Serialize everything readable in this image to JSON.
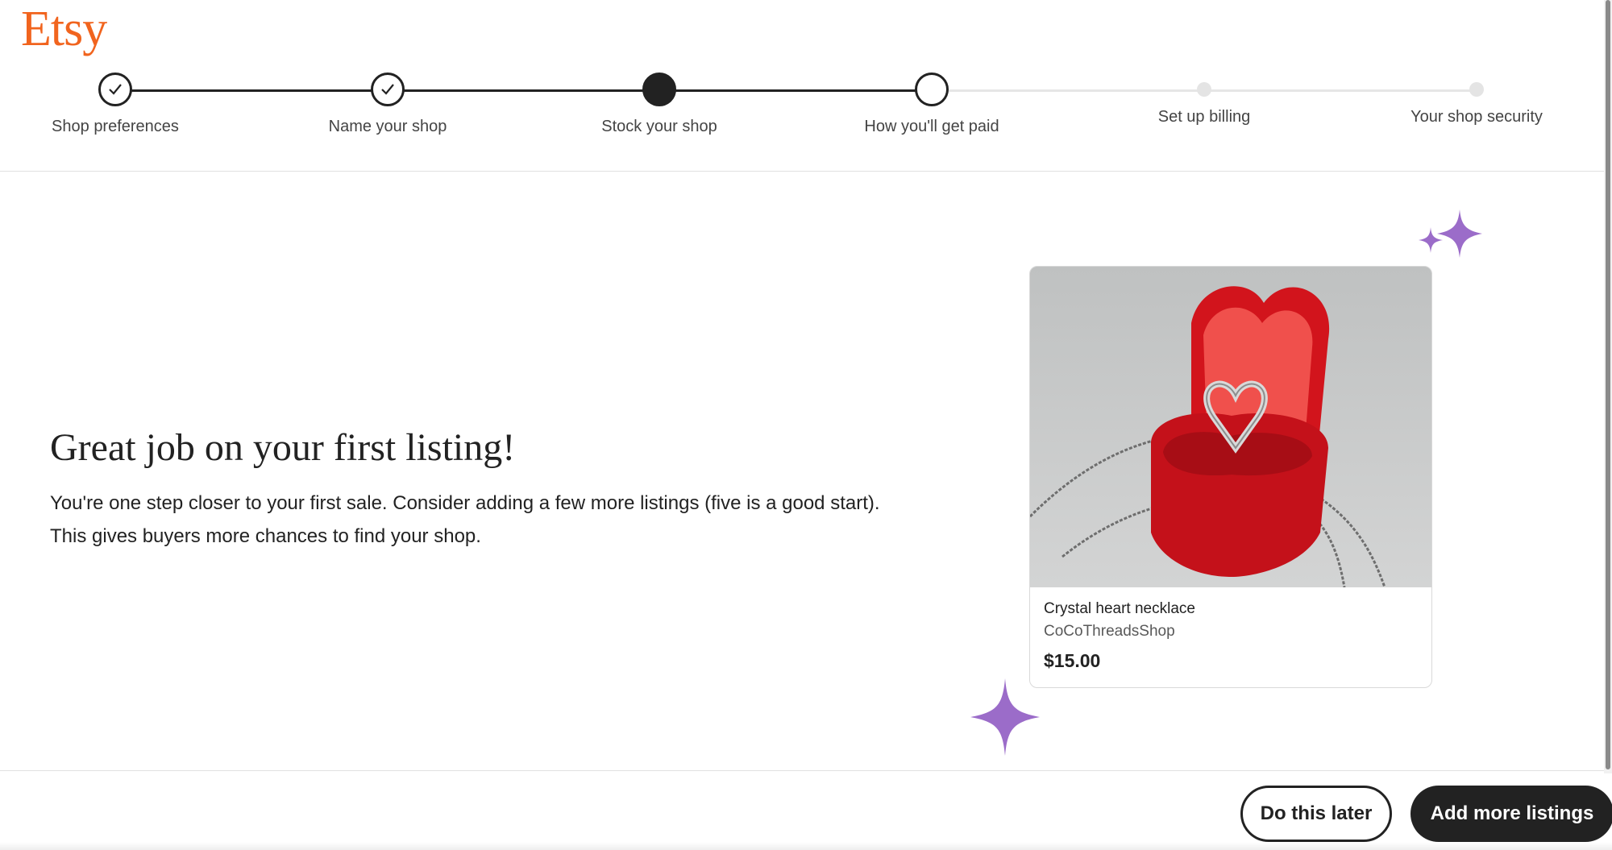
{
  "brand": {
    "logo_text": "Etsy",
    "color": "#f1641e"
  },
  "stepper": {
    "steps": [
      {
        "label": "Shop preferences",
        "state": "completed"
      },
      {
        "label": "Name your shop",
        "state": "completed"
      },
      {
        "label": "Stock your shop",
        "state": "current"
      },
      {
        "label": "How you'll get paid",
        "state": "upcoming"
      },
      {
        "label": "Set up billing",
        "state": "locked"
      },
      {
        "label": "Your shop security",
        "state": "locked"
      }
    ]
  },
  "main": {
    "headline": "Great job on your first listing!",
    "body": "You're one step closer to your first sale. Consider adding a few more listings (five is a good start). This gives buyers more chances to find your shop."
  },
  "listing_card": {
    "title": "Crystal heart necklace",
    "shop": "CoCoThreadsShop",
    "price": "$15.00",
    "image_icon": "heart-necklace-in-red-box-image"
  },
  "footer": {
    "secondary_label": "Do this later",
    "primary_label": "Add more listings"
  },
  "colors": {
    "text": "#222222",
    "accent_sparkle": "#9b6cc9",
    "primary_button": "#222222"
  }
}
